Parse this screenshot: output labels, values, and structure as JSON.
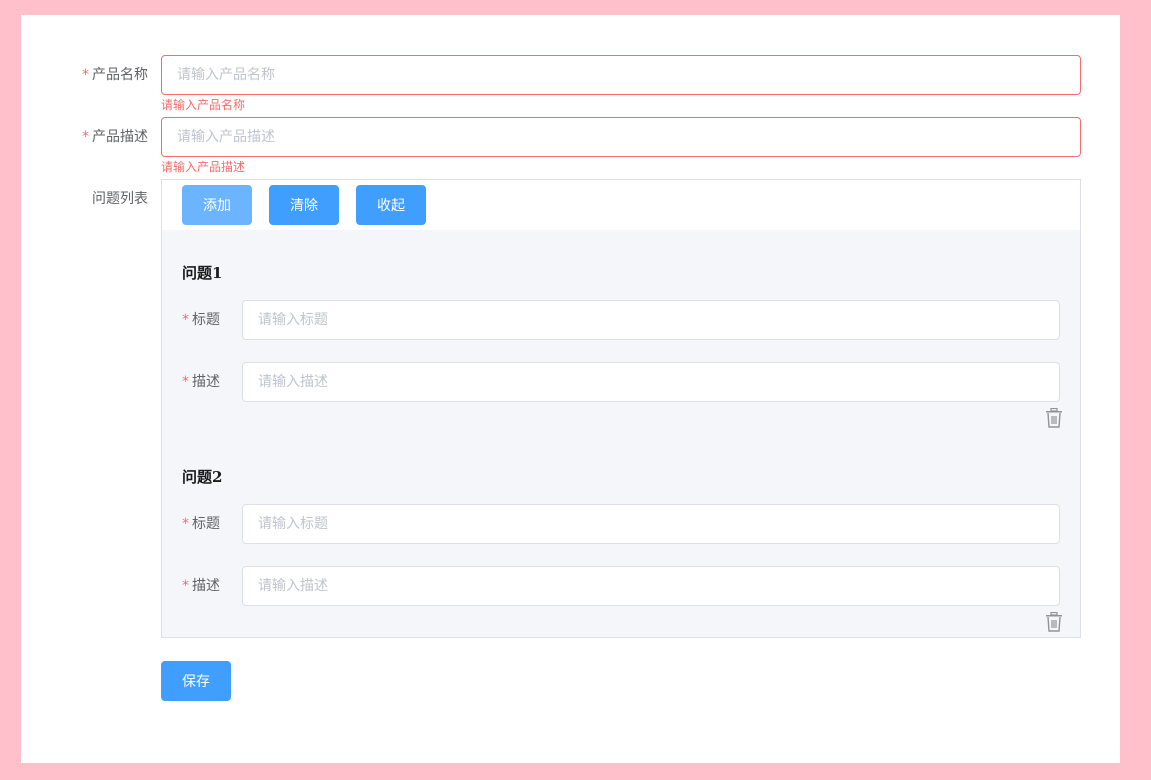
{
  "form": {
    "product_name": {
      "label": "产品名称",
      "required_mark": "*",
      "value": "",
      "placeholder": "请输入产品名称",
      "error": "请输入产品名称"
    },
    "product_desc": {
      "label": "产品描述",
      "required_mark": "*",
      "value": "",
      "placeholder": "请输入产品描述",
      "error": "请输入产品描述"
    },
    "question_list": {
      "label": "问题列表",
      "buttons": {
        "add": "添加",
        "clear": "清除",
        "collapse": "收起"
      },
      "questions": [
        {
          "title": "问题1",
          "title_field": {
            "label": "标题",
            "required_mark": "*",
            "value": "",
            "placeholder": "请输入标题"
          },
          "desc_field": {
            "label": "描述",
            "required_mark": "*",
            "value": "",
            "placeholder": "请输入描述"
          },
          "delete_icon": "trash-icon"
        },
        {
          "title": "问题2",
          "title_field": {
            "label": "标题",
            "required_mark": "*",
            "value": "",
            "placeholder": "请输入标题"
          },
          "desc_field": {
            "label": "描述",
            "required_mark": "*",
            "value": "",
            "placeholder": "请输入描述"
          },
          "delete_icon": "trash-icon"
        }
      ]
    },
    "save_label": "保存"
  },
  "colors": {
    "page_background": "#ffc0cb",
    "primary": "#409eff",
    "error": "#f56c6c",
    "panel_background": "#f4f6fa"
  }
}
